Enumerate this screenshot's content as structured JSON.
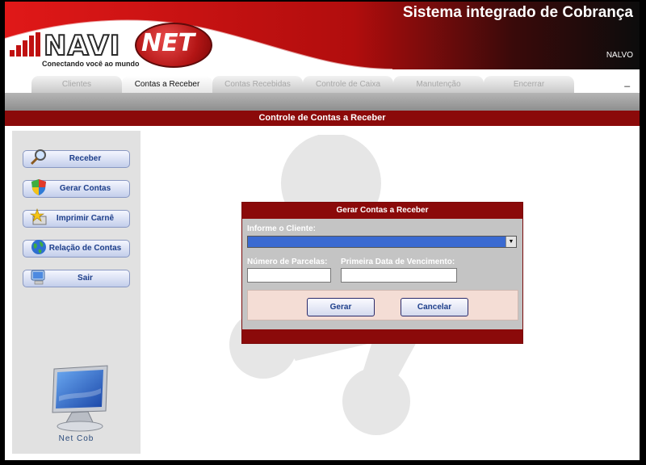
{
  "header": {
    "app_title": "Sistema integrado de Cobrança",
    "user": "NALVO",
    "logo_primary": "NAVI",
    "logo_secondary": "NET",
    "logo_tagline": "Conectando você ao mundo"
  },
  "tabs": [
    {
      "label": "Clientes",
      "active": false
    },
    {
      "label": "Contas a Receber",
      "active": true
    },
    {
      "label": "Contas Recebidas",
      "active": false
    },
    {
      "label": "Controle de Caixa",
      "active": false
    },
    {
      "label": "Manutenção",
      "active": false
    },
    {
      "label": "Encerrar",
      "active": false
    }
  ],
  "minimize_label": "_",
  "section_title": "Controle de Contas a Receber",
  "sidebar": {
    "items": [
      {
        "label": "Receber",
        "icon": "magnifier-icon"
      },
      {
        "label": "Gerar Contas",
        "icon": "shield-icon"
      },
      {
        "label": "Imprimir Carnê",
        "icon": "star-icon"
      },
      {
        "label": "Relação de Contas",
        "icon": "globe-icon"
      },
      {
        "label": "Sair",
        "icon": "computer-icon"
      }
    ],
    "footer_label": "Net Cob"
  },
  "dialog": {
    "title": "Gerar Contas a Receber",
    "client_label": "Informe o Cliente:",
    "client_value": "",
    "installments_label": "Número de Parcelas:",
    "installments_value": "",
    "first_due_label": "Primeira Data de Vencimento:",
    "first_due_value": "",
    "generate_button": "Gerar",
    "cancel_button": "Cancelar"
  },
  "colors": {
    "brand_red": "#8b0a0a",
    "button_text": "#1d3e8a",
    "selection_blue": "#3a6ad1"
  }
}
